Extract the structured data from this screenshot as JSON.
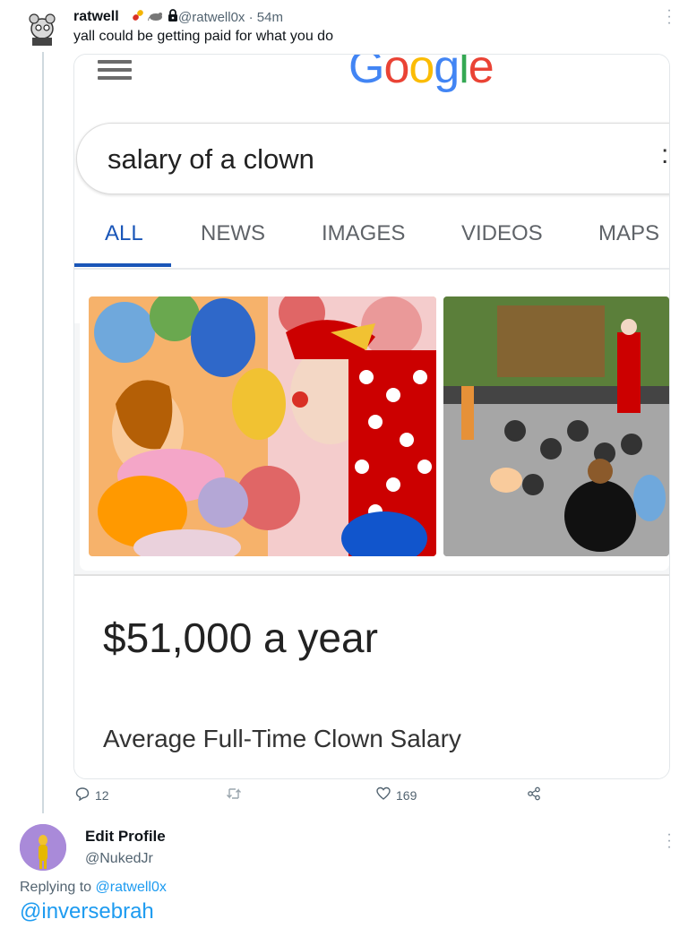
{
  "tweet": {
    "author_name": "ratwell",
    "badges": [
      "pill-emoji",
      "rat-emoji",
      "lock-icon"
    ],
    "handle": "@ratwell0x",
    "dot": "·",
    "time": "54m",
    "text": "yall could be getting paid for what you do",
    "more_icon": "more-dots-icon"
  },
  "screenshot": {
    "logo": "Google",
    "logo_colors": [
      "#4285F4",
      "#EA4335",
      "#FBBC05",
      "#4285F4",
      "#34A853",
      "#EA4335"
    ],
    "search_query": "salary of a clown",
    "search_side": ":",
    "tabs": [
      {
        "label": "ALL",
        "active": true
      },
      {
        "label": "NEWS",
        "active": false
      },
      {
        "label": "IMAGES",
        "active": false
      },
      {
        "label": "VIDEOS",
        "active": false
      },
      {
        "label": "MAPS",
        "active": false
      }
    ],
    "salary": "$51,000 a year",
    "salary_caption": "Average Full-Time Clown Salary"
  },
  "actions": {
    "reply_count": "12",
    "retweet_count": "",
    "like_count": "169"
  },
  "reply": {
    "name": "Edit Profile",
    "handle": "@NukedJr",
    "replying_prefix": "Replying to",
    "replying_to": "@ratwell0x",
    "mention": "@inversebrah"
  },
  "colors": {
    "accent": "#1d9bf0",
    "google_tab_blue": "#1a56b8",
    "muted": "#536471"
  }
}
